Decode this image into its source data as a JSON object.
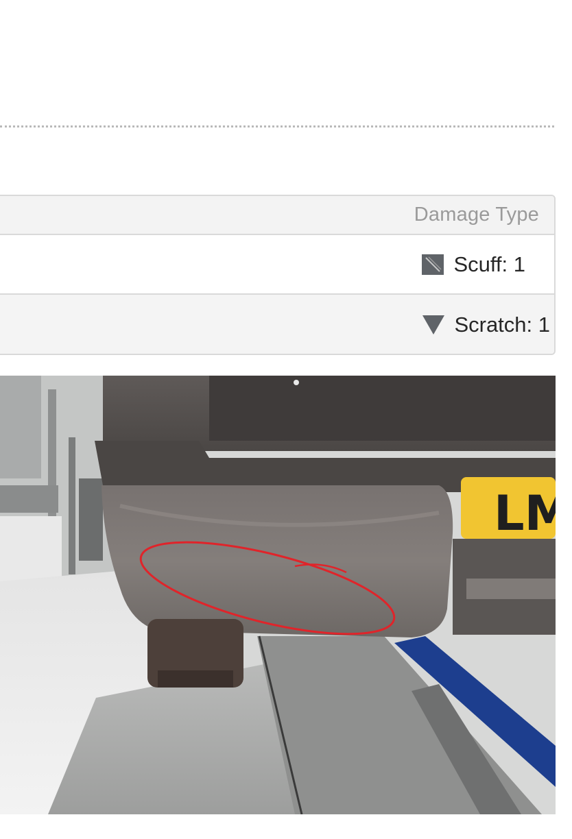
{
  "table": {
    "header": "Damage Type",
    "rows": [
      {
        "icon": "scuff-icon",
        "label": "Scuff: 1"
      },
      {
        "icon": "scratch-triangle-icon",
        "label": "Scratch: 1"
      }
    ]
  },
  "photo": {
    "icon": "vehicle-damage-photo",
    "plate_text": "LM"
  },
  "colors": {
    "annotation": "#e0242a",
    "plate": "#f1c531",
    "header_text": "#9a9a9a"
  }
}
